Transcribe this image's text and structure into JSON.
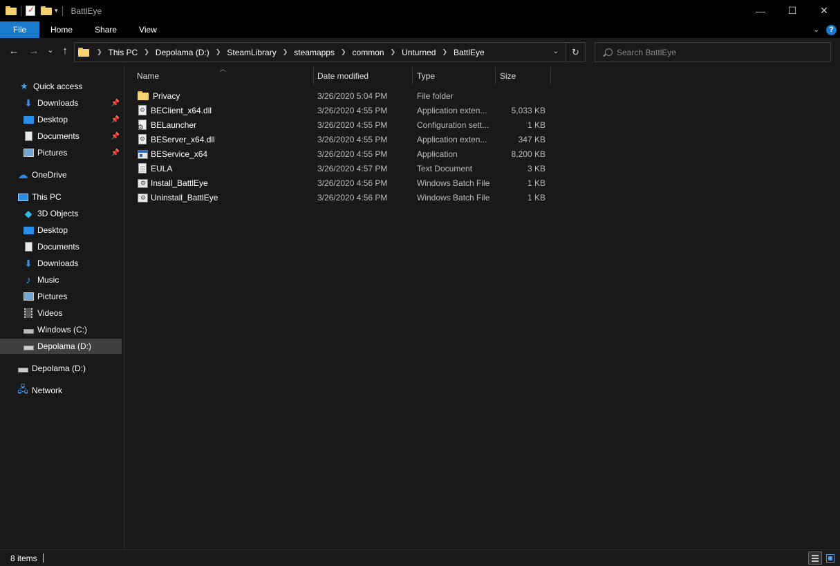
{
  "window": {
    "title": "BattlEye",
    "controls": {
      "minimize": "—",
      "maximize": "☐",
      "close": "✕"
    }
  },
  "ribbon": {
    "tabs": [
      "File",
      "Home",
      "Share",
      "View"
    ],
    "help": "?"
  },
  "nav": {
    "back": "←",
    "forward": "→",
    "recent": "⌄",
    "up": "↑",
    "breadcrumbs": [
      "This PC",
      "Depolama (D:)",
      "SteamLibrary",
      "steamapps",
      "common",
      "Unturned",
      "BattlEye"
    ],
    "refresh": "↻",
    "search_placeholder": "Search BattlEye"
  },
  "sidebar": {
    "items": [
      {
        "label": "Quick access",
        "icon": "star-icon"
      },
      {
        "label": "Downloads",
        "icon": "download-icon",
        "pinned": true
      },
      {
        "label": "Desktop",
        "icon": "desktop-icon",
        "pinned": true
      },
      {
        "label": "Documents",
        "icon": "documents-icon",
        "pinned": true
      },
      {
        "label": "Pictures",
        "icon": "pictures-icon",
        "pinned": true
      },
      {
        "label": "OneDrive",
        "icon": "cloud-icon"
      },
      {
        "label": "This PC",
        "icon": "monitor-icon"
      },
      {
        "label": "3D Objects",
        "icon": "cube-icon"
      },
      {
        "label": "Desktop",
        "icon": "desktop-icon"
      },
      {
        "label": "Documents",
        "icon": "documents-icon"
      },
      {
        "label": "Downloads",
        "icon": "download-icon"
      },
      {
        "label": "Music",
        "icon": "music-icon"
      },
      {
        "label": "Pictures",
        "icon": "pictures-icon"
      },
      {
        "label": "Videos",
        "icon": "video-icon"
      },
      {
        "label": "Windows (C:)",
        "icon": "drive-icon"
      },
      {
        "label": "Depolama (D:)",
        "icon": "drive-icon",
        "selected": true
      },
      {
        "label": "Depolama (D:)",
        "icon": "drive-icon"
      },
      {
        "label": "Network",
        "icon": "network-icon"
      }
    ]
  },
  "columns": {
    "name": "Name",
    "date": "Date modified",
    "type": "Type",
    "size": "Size"
  },
  "files": [
    {
      "name": "Privacy",
      "date": "3/26/2020 5:04 PM",
      "type": "File folder",
      "size": "",
      "icon": "folder-icon"
    },
    {
      "name": "BEClient_x64.dll",
      "date": "3/26/2020 4:55 PM",
      "type": "Application exten...",
      "size": "5,033 KB",
      "icon": "dll-icon"
    },
    {
      "name": "BELauncher",
      "date": "3/26/2020 4:55 PM",
      "type": "Configuration sett...",
      "size": "1 KB",
      "icon": "config-icon"
    },
    {
      "name": "BEServer_x64.dll",
      "date": "3/26/2020 4:55 PM",
      "type": "Application exten...",
      "size": "347 KB",
      "icon": "dll-icon"
    },
    {
      "name": "BEService_x64",
      "date": "3/26/2020 4:55 PM",
      "type": "Application",
      "size": "8,200 KB",
      "icon": "application-icon"
    },
    {
      "name": "EULA",
      "date": "3/26/2020 4:57 PM",
      "type": "Text Document",
      "size": "3 KB",
      "icon": "text-document-icon"
    },
    {
      "name": "Install_BattlEye",
      "date": "3/26/2020 4:56 PM",
      "type": "Windows Batch File",
      "size": "1 KB",
      "icon": "batch-file-icon"
    },
    {
      "name": "Uninstall_BattlEye",
      "date": "3/26/2020 4:56 PM",
      "type": "Windows Batch File",
      "size": "1 KB",
      "icon": "batch-file-icon"
    }
  ],
  "status": {
    "item_count": "8 items"
  },
  "colors": {
    "accent": "#1979ca",
    "background": "#191919",
    "titlebar": "#000000",
    "selected": "#404040",
    "folder": "#f6d271"
  }
}
